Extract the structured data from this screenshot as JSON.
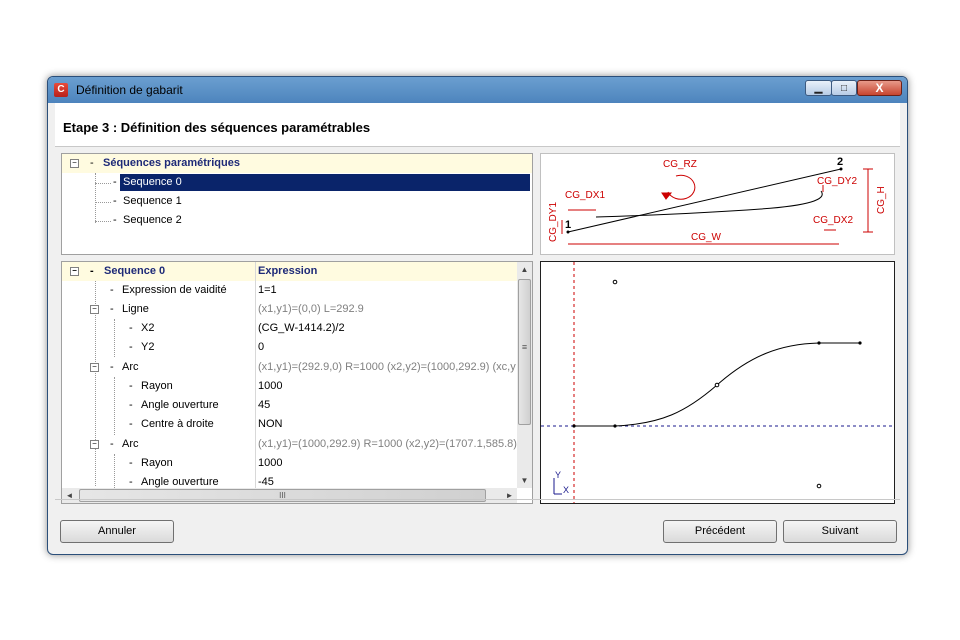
{
  "window": {
    "title": "Définition de gabarit",
    "app_icon_glyph": "C",
    "close_glyph": "X"
  },
  "step_title": "Etape 3 : Définition des séquences paramétrables",
  "tree": {
    "root": "Séquences paramétriques",
    "items": [
      "Sequence 0",
      "Sequence 1",
      "Sequence 2"
    ],
    "selected": "Sequence 0"
  },
  "grid": {
    "header_col1": "Sequence 0",
    "header_col2": "Expression",
    "rows": [
      {
        "label": "Expression de vaidité",
        "value": "1=1",
        "grey": false
      },
      {
        "label": "Ligne",
        "value": "(x1,y1)=(0,0) L=292.9",
        "grey": true
      },
      {
        "label": "X2",
        "value": "(CG_W-1414.2)/2",
        "grey": false
      },
      {
        "label": "Y2",
        "value": "0",
        "grey": false
      },
      {
        "label": "Arc",
        "value": "(x1,y1)=(292.9,0) R=1000 (x2,y2)=(1000,292.9) (xc,y",
        "grey": true
      },
      {
        "label": "Rayon",
        "value": "1000",
        "grey": false
      },
      {
        "label": "Angle ouverture",
        "value": "45",
        "grey": false
      },
      {
        "label": "Centre à droite",
        "value": "NON",
        "grey": false
      },
      {
        "label": "Arc",
        "value": "(x1,y1)=(1000,292.9) R=1000 (x2,y2)=(1707.1,585.8)",
        "grey": true
      },
      {
        "label": "Rayon",
        "value": "1000",
        "grey": false
      },
      {
        "label": "Angle ouverture",
        "value": "-45",
        "grey": false
      }
    ],
    "hscroll_grip": "III",
    "vscroll_grip": "≡"
  },
  "diagram": {
    "labels": {
      "rz": "CG_RZ",
      "dx1": "CG_DX1",
      "dy1": "CG_DY1",
      "dy2": "CG_DY2",
      "h": "CG_H",
      "dx2": "CG_DX2",
      "w": "CG_W",
      "p1": "1",
      "p2": "2"
    },
    "color": "#cc0000"
  },
  "preview": {
    "axis_y": "Y",
    "axis_x": "X"
  },
  "buttons": {
    "cancel": "Annuler",
    "previous": "Précédent",
    "next": "Suivant"
  },
  "colors": {
    "title_bar": "#5a8fc6",
    "selection": "#0a246a",
    "header_text": "#1e2a78",
    "accent_red": "#cc0000",
    "dashed_blue": "#1a1a8c"
  }
}
